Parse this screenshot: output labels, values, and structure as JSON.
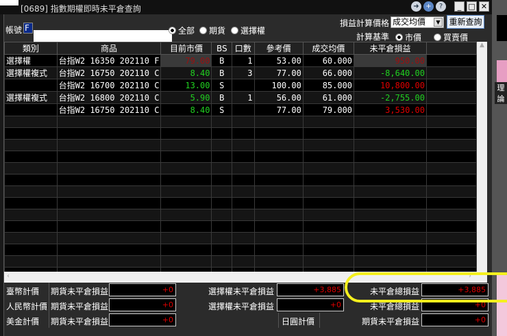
{
  "window": {
    "title": "[0689] 指數期權即時未平倉查詢"
  },
  "toolbar": {
    "account_label": "帳號",
    "account_value": "F",
    "filters": [
      {
        "label": "全部",
        "selected": true
      },
      {
        "label": "期貨",
        "selected": false
      },
      {
        "label": "選擇權",
        "selected": false
      }
    ],
    "price_basis_label": "損益計算價格",
    "price_basis_value": "成交均價",
    "requery_label": "重新查詢",
    "calc_basis_label": "計算基準",
    "calc_options": [
      {
        "label": "市價",
        "selected": true
      },
      {
        "label": "買賣價",
        "selected": false
      }
    ]
  },
  "table": {
    "columns": [
      "類別",
      "商品",
      "目前市價",
      "BS",
      "口數",
      "參考價",
      "成交均價",
      "未平倉損益",
      ""
    ],
    "rows": [
      {
        "type": "選擇權",
        "product": "台指W2 16350 202110 F",
        "market": "79.00",
        "bs": "B",
        "qty": "1",
        "ref": "53.00",
        "avg": "60.000",
        "pnl": "950.00",
        "mcolor": "dred",
        "pcolor": "dred"
      },
      {
        "type": "選擇權複式",
        "product": "台指W2 16750 202110 C",
        "market": "8.40",
        "bs": "B",
        "qty": "3",
        "ref": "77.00",
        "avg": "66.000",
        "pnl": "-8,640.00",
        "mcolor": "green",
        "pcolor": "green"
      },
      {
        "type": "",
        "product": "台指W2 16700 202110 C",
        "market": "13.00",
        "bs": "S",
        "qty": "",
        "ref": "100.00",
        "avg": "85.000",
        "pnl": "10,800.00",
        "mcolor": "green",
        "pcolor": "red"
      },
      {
        "type": "選擇權複式",
        "product": "台指W2 16800 202110 C",
        "market": "5.90",
        "bs": "B",
        "qty": "1",
        "ref": "56.00",
        "avg": "61.000",
        "pnl": "-2,755.00",
        "mcolor": "green",
        "pcolor": "green"
      },
      {
        "type": "",
        "product": "台指W2 16750 202110 C",
        "market": "8.40",
        "bs": "S",
        "qty": "",
        "ref": "77.00",
        "avg": "79.000",
        "pnl": "3,530.00",
        "mcolor": "green",
        "pcolor": "red"
      }
    ]
  },
  "summary": {
    "twd": {
      "label": "臺幣計價",
      "fut_label": "期貨未平倉損益",
      "fut": "+0",
      "opt_label": "選擇權未平倉損益",
      "opt": "+3,885",
      "total_label": "未平倉總損益",
      "total": "+3,885"
    },
    "cny": {
      "label": "人民幣計價",
      "fut_label": "期貨未平倉損益",
      "fut": "+0",
      "opt_label": "選擇權未平倉損益",
      "opt": "+0",
      "total_label": "未平倉總損益",
      "total": "+0"
    },
    "usd": {
      "label": "美金計價",
      "fut_label": "期貨未平倉損益",
      "fut": "+0"
    },
    "jpy": {
      "label": "日圓計價",
      "fut_label": "期貨未平倉損益",
      "fut": "+0"
    }
  }
}
